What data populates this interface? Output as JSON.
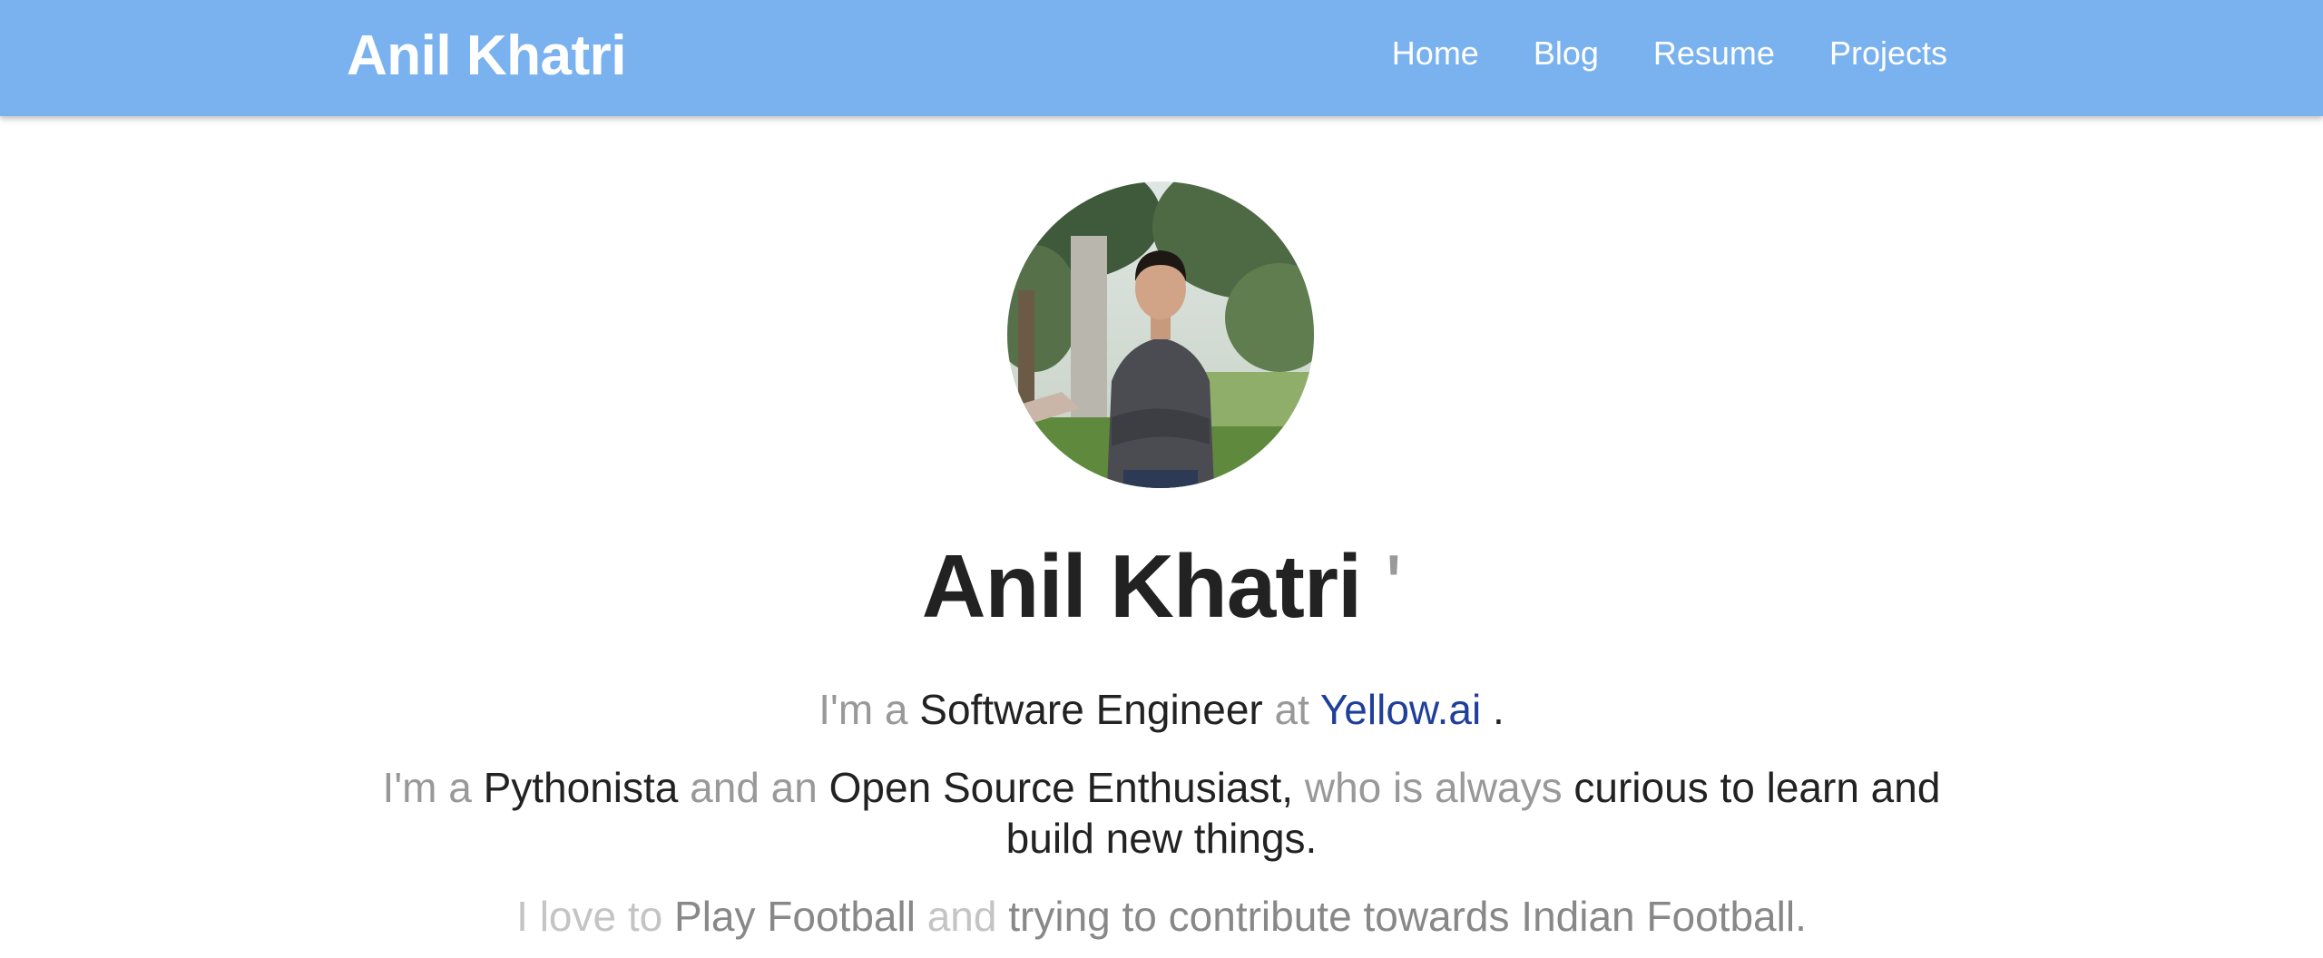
{
  "navbar": {
    "brand": "Anil Khatri",
    "links": [
      "Home",
      "Blog",
      "Resume",
      "Projects"
    ],
    "background_color": "#7ab2ef"
  },
  "hero": {
    "avatar_icon": "profile-photo",
    "name": "Anil Khatri",
    "cursor": "'"
  },
  "intro": {
    "line1": {
      "prefix": "I'm a",
      "role": "Software Engineer",
      "at": "at",
      "company": "Yellow.ai",
      "end": "."
    },
    "line2": {
      "prefix": "I'm a",
      "p1": "Pythonista",
      "mid1": "and an",
      "p2": "Open Source Enthusiast,",
      "mid2": "who is always",
      "p3": "curious to learn and build new things."
    },
    "line3": {
      "prefix": "I love to",
      "p1": "Play Football",
      "mid": "and",
      "p2": "trying to contribute towards Indian Football."
    }
  }
}
